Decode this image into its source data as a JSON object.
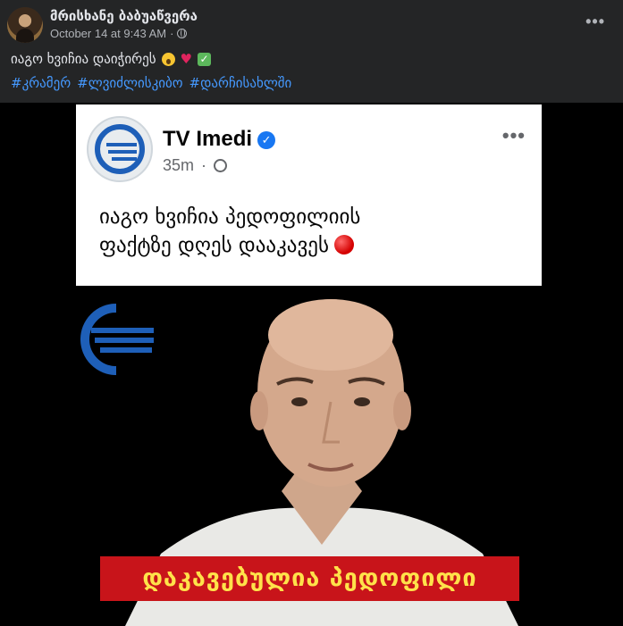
{
  "post": {
    "author": "მრისხანე ბაბუაწვერა",
    "timestamp": "October 14 at 9:43 AM",
    "meta_separator": "·",
    "more_label": "•••",
    "caption": "იაგო ხვიჩია დაიჭირეს",
    "check_mark": "✓",
    "heart": "♥",
    "hashtags": [
      "#კრამერ",
      "#ლვიძლისკიბო",
      "#დარჩისახლში"
    ]
  },
  "shared_card": {
    "page_name": "TV Imedi",
    "verified_mark": "✓",
    "time": "35m",
    "separator": "·",
    "more_label": "•••",
    "text": "იაგო ხვიჩია პედოფილიის\nფაქტზე დღეს დააკავეს"
  },
  "video": {
    "banner_text": "დაკავებულია პედოფილი"
  },
  "colors": {
    "background": "#242526",
    "hashtag": "#4599ff",
    "banner": "#c8141a",
    "banner_text": "#ffe24a",
    "logo_blue": "#1e5fb8",
    "verified": "#1877f2"
  }
}
